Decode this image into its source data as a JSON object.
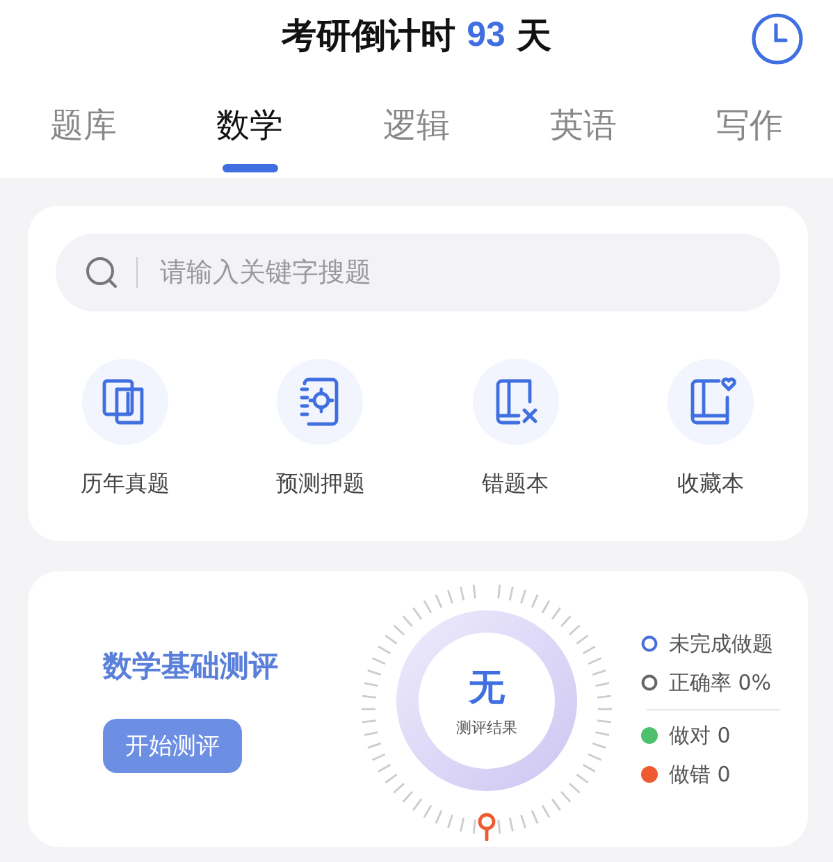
{
  "header": {
    "title_prefix": "考研倒计时",
    "days": "93",
    "title_suffix": "天"
  },
  "tabs": [
    {
      "label": "题库",
      "selected": false
    },
    {
      "label": "数学",
      "selected": true
    },
    {
      "label": "逻辑",
      "selected": false
    },
    {
      "label": "英语",
      "selected": false
    },
    {
      "label": "写作",
      "selected": false
    }
  ],
  "search": {
    "placeholder": "请输入关键字搜题"
  },
  "shortcuts": [
    {
      "kind": "books",
      "label": "历年真题"
    },
    {
      "kind": "target",
      "label": "预测押题"
    },
    {
      "kind": "wrong",
      "label": "错题本"
    },
    {
      "kind": "favorite",
      "label": "收藏本"
    }
  ],
  "assessment": {
    "title": "数学基础测评",
    "button": "开始测评",
    "result": "无",
    "result_label": "测评结果",
    "legend": [
      {
        "kind": "ring",
        "color": "#4a6fd8",
        "label": "未完成做题"
      },
      {
        "kind": "ring",
        "color": "#666666",
        "label": "正确率 0%"
      },
      {
        "kind": "dot",
        "color": "#4cc06a",
        "label": "做对 0"
      },
      {
        "kind": "dot",
        "color": "#f05a30",
        "label": "做错 0"
      }
    ]
  }
}
